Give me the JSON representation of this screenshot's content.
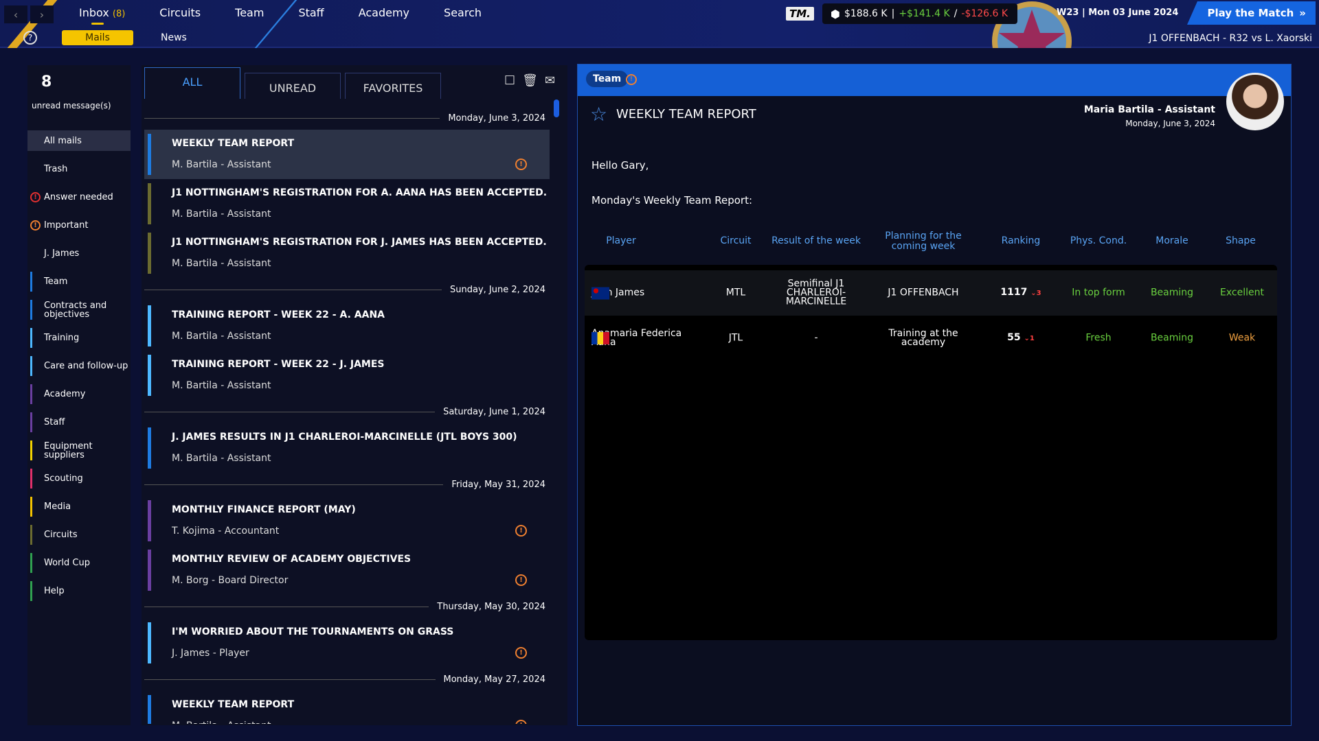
{
  "topbar": {
    "nav": [
      {
        "label": "Inbox",
        "count": "(8)"
      },
      {
        "label": "Circuits"
      },
      {
        "label": "Team"
      },
      {
        "label": "Staff"
      },
      {
        "label": "Academy"
      },
      {
        "label": "Search"
      }
    ],
    "subnav": {
      "mails": "Mails",
      "news": "News"
    },
    "help": "?",
    "logo": "TM.",
    "balance": "$188.6 K",
    "income": "+$141.4 K",
    "expense": "-$126.6 K",
    "sep1": "|",
    "sep2": "/",
    "date": "W23 | Mon 03 June 2024",
    "play": "Play the Match",
    "play_icon": "»",
    "match": "J1 OFFENBACH - R32 vs L. Xaorski"
  },
  "sidebar": {
    "count": "8",
    "count_label": "unread message(s)",
    "items": [
      {
        "label": "All mails",
        "selected": true
      },
      {
        "label": "Trash"
      },
      {
        "label": "Answer needed",
        "icon": "alert",
        "color": "#e53030"
      },
      {
        "label": "Important",
        "icon": "alert",
        "color": "#f08030"
      },
      {
        "label": "J. James"
      },
      {
        "label": "Team",
        "color": "#1e7be0"
      },
      {
        "label": "Contracts and objectives",
        "color": "#1e7be0"
      },
      {
        "label": "Training",
        "color": "#4db8ff"
      },
      {
        "label": "Care and follow-up",
        "color": "#4db8ff"
      },
      {
        "label": "Academy",
        "color": "#6a3fa0"
      },
      {
        "label": "Staff",
        "color": "#6a3fa0"
      },
      {
        "label": "Equipment suppliers",
        "color": "#f2d200"
      },
      {
        "label": "Scouting",
        "color": "#e0306a"
      },
      {
        "label": "Media",
        "color": "#f2c200"
      },
      {
        "label": "Circuits",
        "color": "#6b6b30"
      },
      {
        "label": "World Cup",
        "color": "#30a050"
      },
      {
        "label": "Help",
        "color": "#30a050"
      }
    ]
  },
  "list": {
    "tabs": [
      "ALL",
      "UNREAD",
      "FAVORITES"
    ],
    "groups": [
      {
        "date": "Monday, June 3, 2024",
        "mails": [
          {
            "title": "WEEKLY TEAM REPORT",
            "sender": "M. Bartila - Assistant",
            "color": "#1e7be0",
            "warn": true,
            "selected": true
          },
          {
            "title": "J1 NOTTINGHAM'S REGISTRATION FOR A. AANA HAS BEEN ACCEPTED.",
            "sender": "M. Bartila - Assistant",
            "color": "#6b6b30"
          },
          {
            "title": "J1 NOTTINGHAM'S REGISTRATION FOR J. JAMES HAS BEEN ACCEPTED.",
            "sender": "M. Bartila - Assistant",
            "color": "#6b6b30"
          }
        ]
      },
      {
        "date": "Sunday, June 2, 2024",
        "mails": [
          {
            "title": "TRAINING REPORT - WEEK 22 - A. AANA",
            "sender": "M. Bartila - Assistant",
            "color": "#4db8ff"
          },
          {
            "title": "TRAINING REPORT - WEEK 22 - J. JAMES",
            "sender": "M. Bartila - Assistant",
            "color": "#4db8ff"
          }
        ]
      },
      {
        "date": "Saturday, June 1, 2024",
        "mails": [
          {
            "title": "J. JAMES RESULTS IN J1 CHARLEROI-MARCINELLE (JTL BOYS 300)",
            "sender": "M. Bartila - Assistant",
            "color": "#1e7be0"
          }
        ]
      },
      {
        "date": "Friday, May 31, 2024",
        "mails": [
          {
            "title": "MONTHLY FINANCE REPORT (MAY)",
            "sender": "T. Kojima - Accountant",
            "color": "#6a3fa0",
            "warn": true
          },
          {
            "title": "MONTHLY REVIEW OF ACADEMY OBJECTIVES",
            "sender": "M. Borg - Board Director",
            "color": "#6a3fa0",
            "warn": true
          }
        ]
      },
      {
        "date": "Thursday, May 30, 2024",
        "mails": [
          {
            "title": "I'M WORRIED ABOUT THE TOURNAMENTS ON GRASS",
            "sender": "J. James - Player",
            "color": "#4db8ff",
            "warn": true
          }
        ]
      },
      {
        "date": "Monday, May 27, 2024",
        "mails": [
          {
            "title": "WEEKLY TEAM REPORT",
            "sender": "M. Bartila - Assistant",
            "color": "#1e7be0",
            "warn": true
          }
        ]
      }
    ]
  },
  "detail": {
    "chip": "Team",
    "title": "WEEKLY TEAM REPORT",
    "sender": "Maria Bartila - Assistant",
    "date": "Monday, June 3, 2024",
    "greeting": "Hello Gary,",
    "intro": "Monday's Weekly Team Report:",
    "columns": [
      "Player",
      "Circuit",
      "Result of the week",
      "Planning for the coming week",
      "Ranking",
      "Phys. Cond.",
      "Morale",
      "Shape"
    ],
    "rows": [
      {
        "flag": "australia",
        "player": "John James",
        "circuit": "MTL",
        "result": "Semifinal J1 CHARLEROI-MARCINELLE",
        "planning": "J1 OFFENBACH",
        "ranking": "1117",
        "change": "3",
        "phys": "In top form",
        "phys_color": "#6ad13f",
        "morale": "Beaming",
        "morale_color": "#6ad13f",
        "shape": "Excellent",
        "shape_color": "#6ad13f"
      },
      {
        "flag": "romania",
        "player": "Anamaria Federica Aana",
        "circuit": "JTL",
        "result": "-",
        "planning": "Training at the academy",
        "ranking": "55",
        "change": "1",
        "phys": "Fresh",
        "phys_color": "#6ad13f",
        "morale": "Beaming",
        "morale_color": "#6ad13f",
        "shape": "Weak",
        "shape_color": "#f0a040"
      }
    ]
  }
}
